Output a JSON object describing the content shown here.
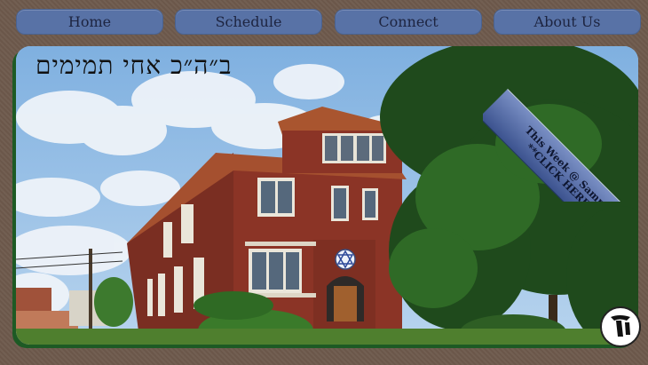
{
  "nav": {
    "items": [
      {
        "label": "Home"
      },
      {
        "label": "Schedule"
      },
      {
        "label": "Connect"
      },
      {
        "label": "About Us"
      }
    ]
  },
  "hero": {
    "hebrew_heading": "ב״ה״כ אחי תמימים",
    "ribbon": {
      "line1": "This Week @ Samnac",
      "line2": "**CLICK HERE**"
    }
  },
  "colors": {
    "nav_button": "#5872a6",
    "background": "#6e5a4c",
    "ribbon": "#4e64a0",
    "hero_shadow": "#1d5a24"
  },
  "icons": [
    "star-of-david-icon",
    "logo-icon"
  ]
}
